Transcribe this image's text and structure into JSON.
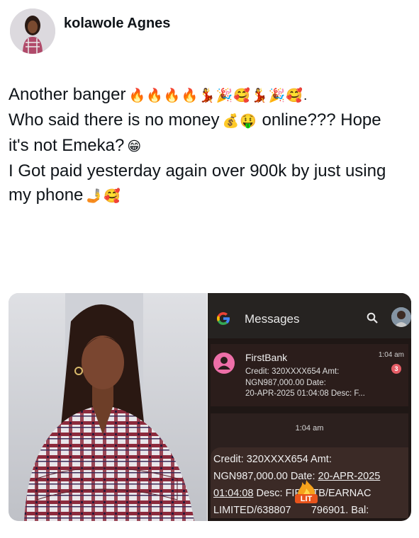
{
  "tweet": {
    "author_name": "kolawole Agnes",
    "lines": [
      {
        "text": "Another banger",
        "emoji": "🔥🔥🔥🔥💃🎉🥰💃🎉🥰."
      },
      {
        "text": "Who said there is no money",
        "emoji": "💰🤑",
        "text_after": " online??? Hope"
      },
      {
        "text": "it's not Emeka?",
        "emoji": "😁"
      },
      {
        "text": "I Got paid yesterday again over 900k by just using"
      },
      {
        "text": "my phone",
        "emoji": "🤳🥰"
      }
    ]
  },
  "messages_screenshot": {
    "app_title": "Messages",
    "google_letter": "G",
    "thread": {
      "sender": "FirstBank",
      "time": "1:04 am",
      "unread_count": "3",
      "snippet_lines": [
        "Credit: 320XXXX654 Amt:",
        "NGN987,000.00 Date:",
        "20-APR-2025 01:04:08 Desc: F..."
      ]
    },
    "conversation": {
      "time": "1:04 am",
      "lines": [
        {
          "parts": [
            {
              "t": "Credit: 320XXXX654 Amt:"
            }
          ]
        },
        {
          "parts": [
            {
              "t": "NGN987,000.00 Date: "
            },
            {
              "t": "20-APR-2025",
              "u": true
            }
          ]
        },
        {
          "parts": [
            {
              "t": "01:04:08",
              "u": true
            },
            {
              "t": " Desc: FIP:GTB/EARNAC"
            }
          ]
        },
        {
          "parts": [
            {
              "t": "LIMITED/638807"
            },
            {
              "t": "       "
            },
            {
              "t": "796901. Bal:"
            }
          ]
        }
      ],
      "badge_text": "LIT"
    }
  },
  "colors": {
    "messages_bg": "#1f1715",
    "bubble_bg": "#3b2a26",
    "avatar_pink": "#ee6fa8",
    "unread_red": "#e55d66"
  }
}
